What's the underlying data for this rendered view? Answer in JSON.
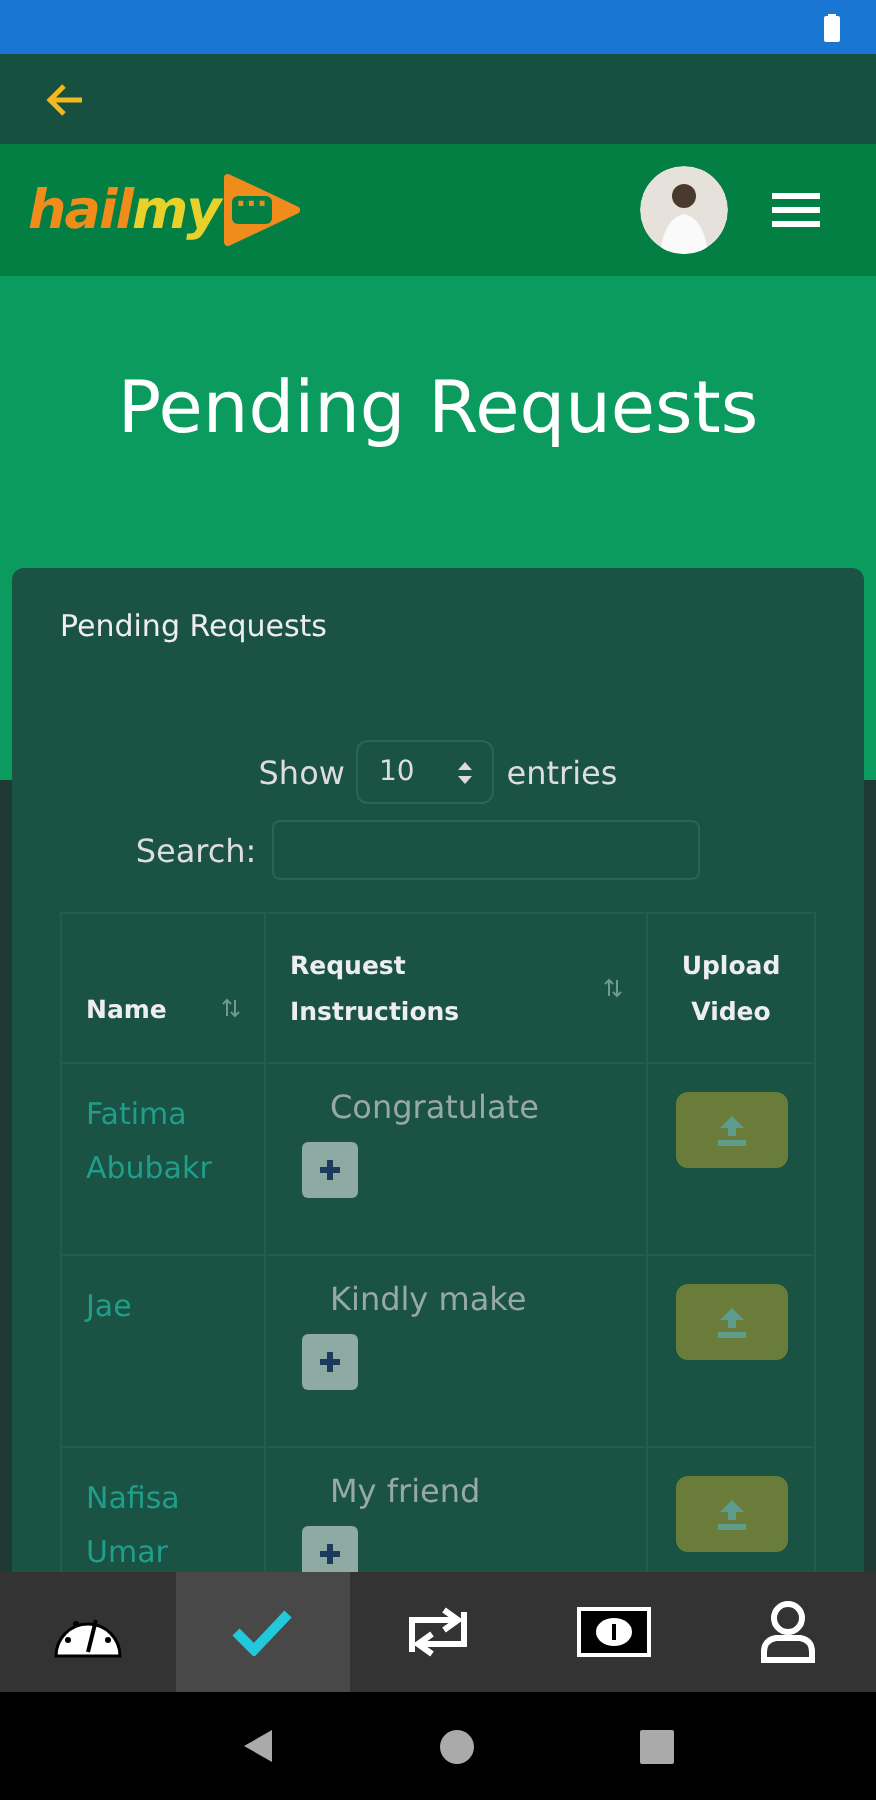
{
  "logo": {
    "part_1": "hail",
    "part_2": "my",
    "mark": "..."
  },
  "hero": {
    "title": "Pending Requests"
  },
  "card": {
    "title": "Pending Requests",
    "length": {
      "before": "Show",
      "value": "10",
      "after": "entries"
    },
    "search": {
      "label": "Search:"
    },
    "columns": [
      {
        "label": "Name",
        "sortable": true
      },
      {
        "label": "Request Instructions",
        "sortable": true
      },
      {
        "label": "Upload Video",
        "sortable": false
      }
    ],
    "rows": [
      {
        "name": "Fatima Abubakr",
        "instructions": "Congratulate"
      },
      {
        "name": "Jae",
        "instructions": "Kindly make"
      },
      {
        "name": "Nafisa Umar",
        "instructions": "My friend"
      }
    ]
  },
  "bottom_nav": [
    {
      "kind": "dashboard",
      "selected": false
    },
    {
      "kind": "check",
      "selected": true
    },
    {
      "kind": "transfer",
      "selected": false
    },
    {
      "kind": "money",
      "selected": false
    },
    {
      "kind": "profile",
      "selected": false
    }
  ]
}
